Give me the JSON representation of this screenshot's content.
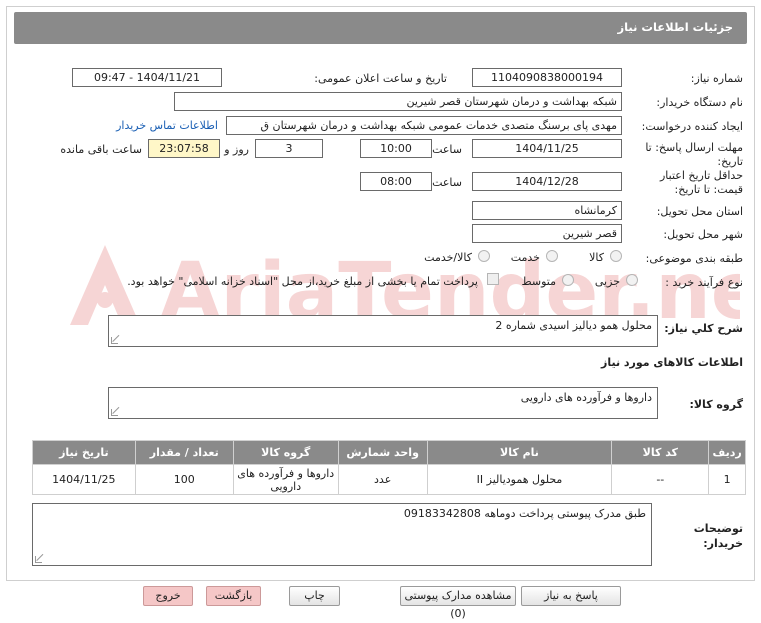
{
  "header": {
    "title": "جزئیات اطلاعات نیاز"
  },
  "form": {
    "need_number_label": "شماره نیاز:",
    "need_number": "1104090838000194",
    "announce_label": "تاریخ و ساعت اعلان عمومی:",
    "announce_value": "1404/11/21 - 09:47",
    "buyer_org_label": "نام دستگاه خریدار:",
    "buyer_org": "شبکه بهداشت و درمان شهرستان قصر شیرین",
    "creator_label": "ایجاد کننده درخواست:",
    "creator": "مهدی پای برسنگ متصدی خدمات عمومی شبکه بهداشت و درمان شهرستان ق",
    "contact_link": "اطلاعات تماس خریدار",
    "deadline_label_1": "مهلت ارسال پاسخ: تا",
    "deadline_label_2": "تاریخ:",
    "deadline_date": "1404/11/25",
    "time_label": "ساعت",
    "deadline_time": "10:00",
    "days_value": "3",
    "days_label": "روز و",
    "remaining_time": "23:07:58",
    "remaining_label": "ساعت باقی مانده",
    "validity_label_1": "حداقل تاریخ اعتبار",
    "validity_label_2": "قیمت: تا تاریخ:",
    "validity_date": "1404/12/28",
    "validity_time": "08:00",
    "province_label": "استان محل تحویل:",
    "province": "کرمانشاه",
    "city_label": "شهر محل تحویل:",
    "city": "قصر شیرین",
    "category_label": "طبقه بندی موضوعی:",
    "category_options": [
      "کالا",
      "خدمت",
      "کالا/خدمت"
    ],
    "process_label": "نوع فرآیند خرید :",
    "process_options": [
      "جزیی",
      "متوسط"
    ],
    "payment_note": "پرداخت تمام یا بخشی از مبلغ خرید،از محل \"اسناد خزانه اسلامی\" خواهد بود.",
    "description_label": "شرح کلي نياز:",
    "description": "محلول همو دیالیز اسیدی شماره 2",
    "goods_info_title": "اطلاعات کالاهای مورد نیاز",
    "goods_group_label": "گروه کالا:",
    "goods_group": "داروها و فرآورده های دارویی"
  },
  "table": {
    "headers": [
      "ردیف",
      "کد کالا",
      "نام کالا",
      "واحد شمارش",
      "گروه کالا",
      "تعداد / مقدار",
      "تاریخ نیاز"
    ],
    "rows": [
      [
        "1",
        "--",
        "محلول همودیالیز II",
        "عدد",
        "داروها و فرآورده های دارویی",
        "100",
        "1404/11/25"
      ]
    ]
  },
  "buyer_notes": {
    "label_1": "توضیحات",
    "label_2": "خریدار:",
    "text": "طبق مدرک پیوستی پرداخت دوماهه 09183342808"
  },
  "buttons": {
    "reply": "پاسخ به نیاز",
    "attachments": "مشاهده مدارک پیوستی (0)",
    "print": "چاپ",
    "back": "بازگشت",
    "exit": "خروج"
  },
  "watermark": {
    "text": "AriaTender.neT"
  }
}
